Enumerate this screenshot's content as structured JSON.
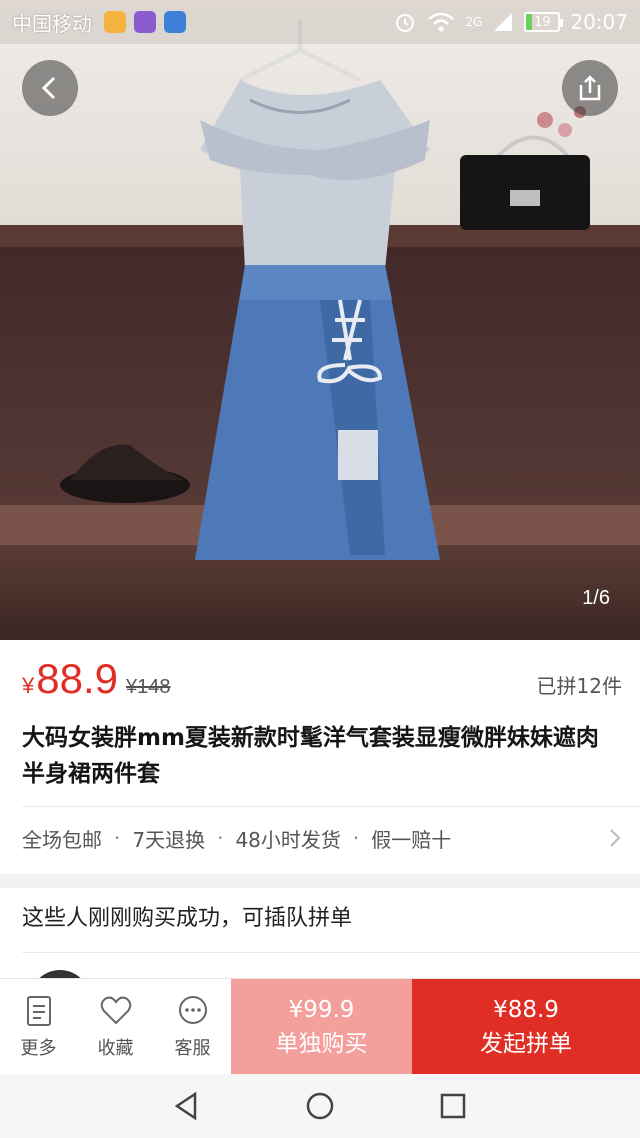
{
  "status_bar": {
    "carrier": "中国移动",
    "network": "2G",
    "battery": "19",
    "time": "20:07"
  },
  "gallery": {
    "page_indicator": "1/6"
  },
  "product": {
    "currency": "¥",
    "price": "88.9",
    "original_price": "¥148",
    "sold_count": "已拼12件",
    "title": "大码女装胖mm夏装新款时髦洋气套装显瘦微胖妹妹遮肉半身裙两件套"
  },
  "services": [
    "全场包邮",
    "7天退换",
    "48小时发货",
    "假一赔十"
  ],
  "group_join": {
    "title": "这些人刚刚购买成功，可插队拼单"
  },
  "action_bar": {
    "more_label": "更多",
    "favorite_label": "收藏",
    "service_label": "客服",
    "single_price": "¥99.9",
    "single_label": "单独购买",
    "group_price": "¥88.9",
    "group_label": "发起拼单"
  },
  "colors": {
    "accent_red": "#e02e24",
    "single_buy_pink": "#f3a09c"
  }
}
